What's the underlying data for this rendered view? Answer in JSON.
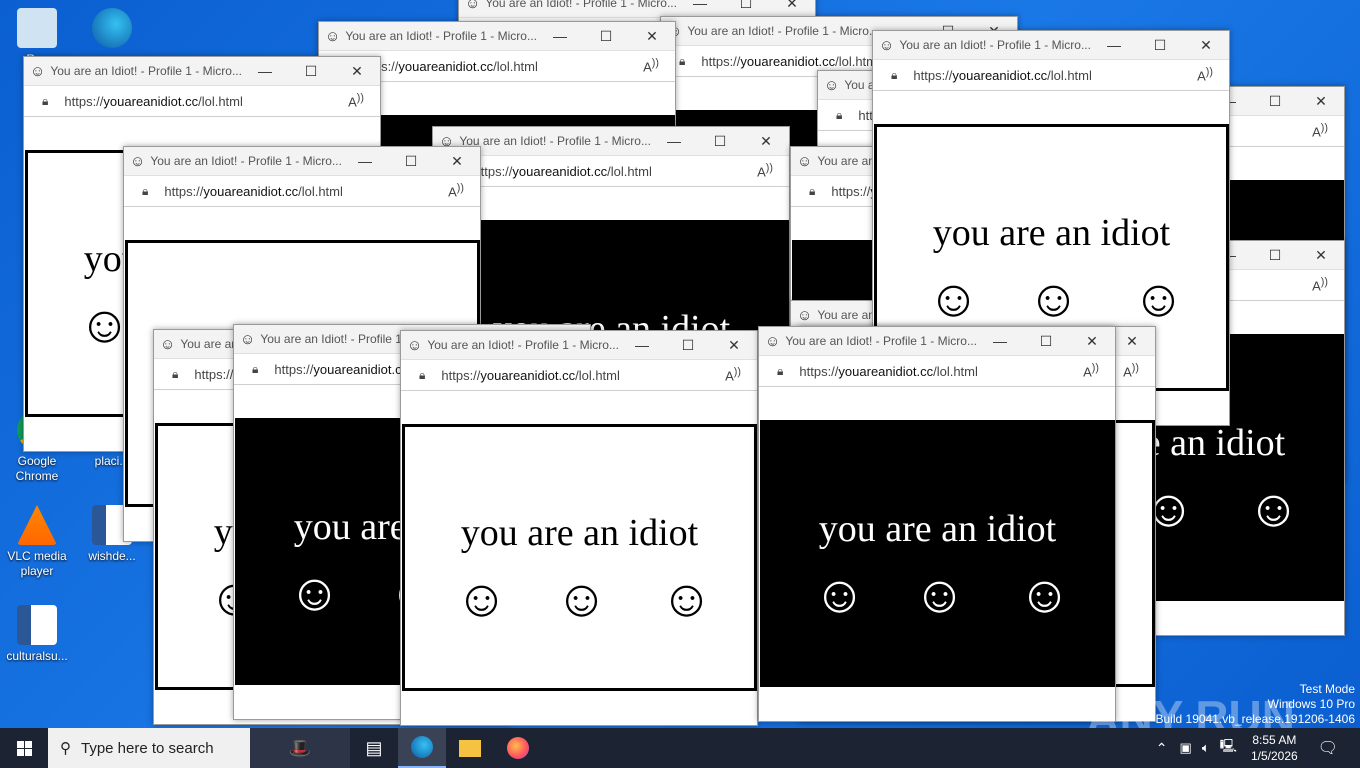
{
  "desktop": {
    "icons": [
      {
        "label": "Rec",
        "name": "recycle-bin"
      },
      {
        "label": "Google Chrome",
        "name": "google-chrome"
      },
      {
        "label": "VLC media player",
        "name": "vlc-media-player"
      },
      {
        "label": "wishde...",
        "name": "wishde-doc"
      },
      {
        "label": "placi...",
        "name": "placi-shortcut"
      },
      {
        "label": "culturalsu...",
        "name": "culturalsu-doc"
      }
    ]
  },
  "window": {
    "title": "You are an Idiot! - Profile 1 - Micro...",
    "url_prefix": "https://",
    "url_host": "youareanidiot.cc",
    "url_path": "/lol.html",
    "minimize": "—",
    "maximize": "☐",
    "close": "✕",
    "message": "you are an idiot",
    "smiley": "☺"
  },
  "taskbar": {
    "search_placeholder": "Type here to search",
    "time": "8:55 AM",
    "date": "1/5/2026"
  },
  "watermark": {
    "line1": "Test Mode",
    "line2": "Windows 10 Pro",
    "line3": "Build 19041.vb_release.191206-1406",
    "logo": "ANY RUN"
  },
  "colors": {
    "desktop": "#0a64d8",
    "taskbar": "#1c2433"
  }
}
